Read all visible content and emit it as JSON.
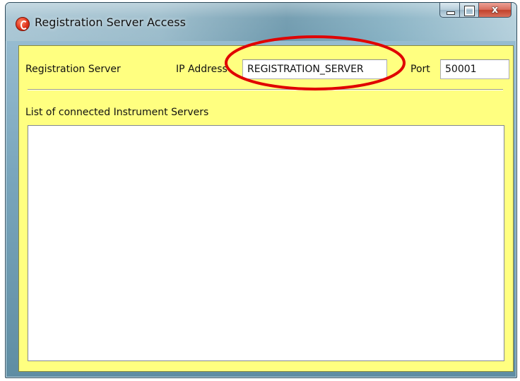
{
  "window": {
    "title": "Registration Server Access"
  },
  "title_buttons": {
    "minimize": "minimize",
    "maximize": "maximize",
    "close": "x"
  },
  "form": {
    "section_label": "Registration Server",
    "ip_label": "IP Address",
    "ip_value": "REGISTRATION_SERVER",
    "port_label": "Port",
    "port_value": "50001",
    "list_label": "List of connected Instrument Servers",
    "list_items": []
  },
  "colors": {
    "client_background": "#ffff80",
    "annotation": "#e00000"
  },
  "icons": {
    "app": "app-logo-icon",
    "minimize": "minimize-icon",
    "maximize": "maximize-icon",
    "close": "close-icon"
  }
}
